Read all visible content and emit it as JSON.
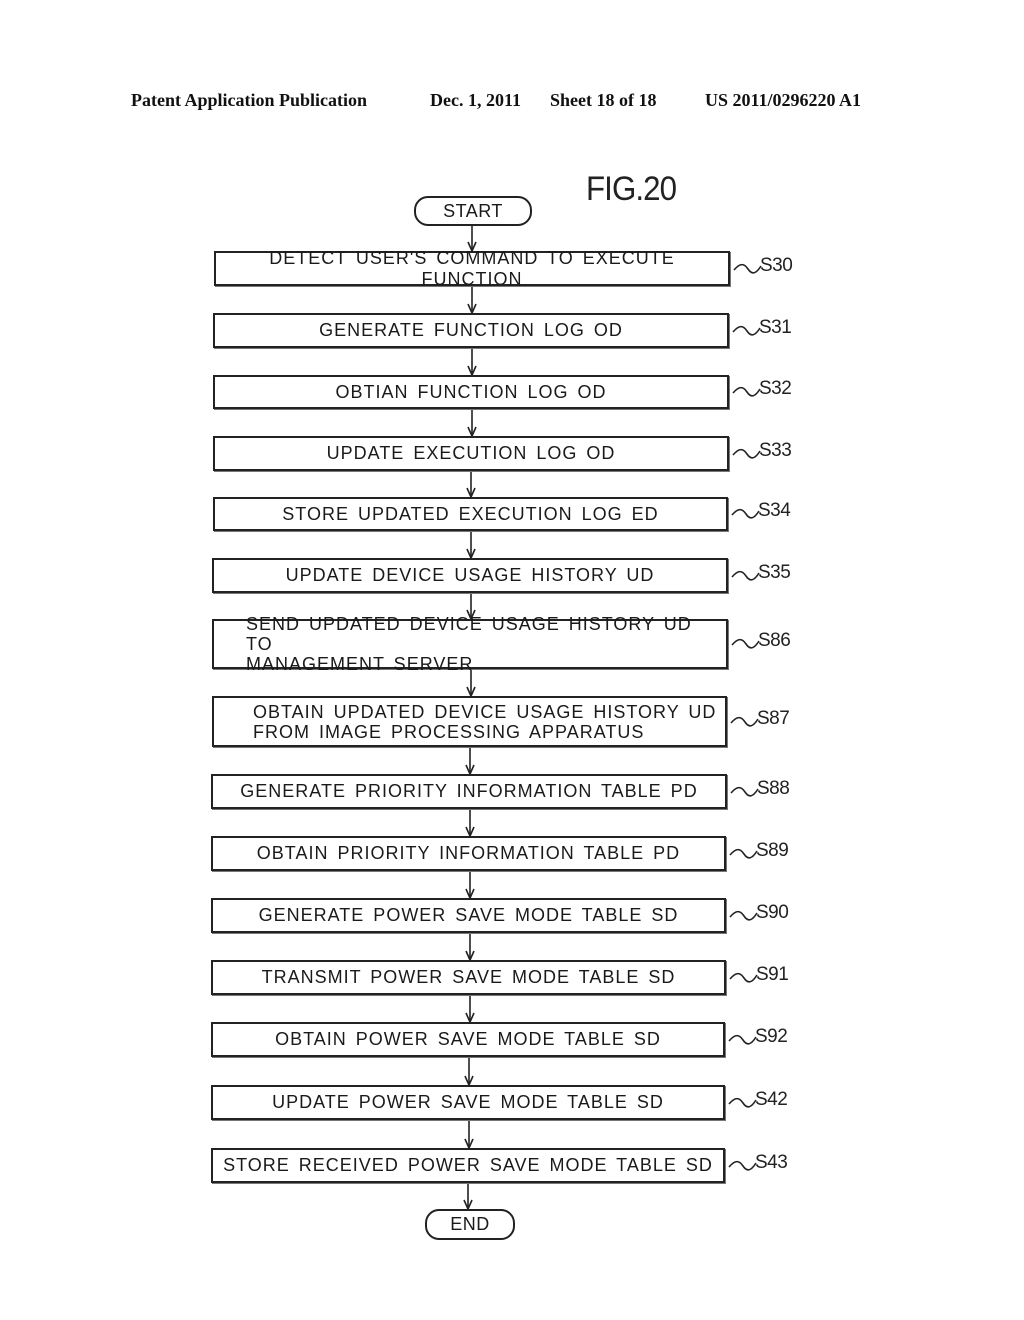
{
  "header": {
    "publication": "Patent Application Publication",
    "date": "Dec. 1, 2011",
    "sheet": "Sheet 18 of 18",
    "number": "US 2011/0296220 A1"
  },
  "figure": {
    "title": "FIG.20",
    "start_label": "START",
    "end_label": "END",
    "steps": [
      {
        "id": "S30",
        "label": "DETECT USER'S COMMAND TO EXECUTE FUNCTION"
      },
      {
        "id": "S31",
        "label": "GENERATE FUNCTION LOG OD"
      },
      {
        "id": "S32",
        "label": "OBTIAN FUNCTION LOG OD"
      },
      {
        "id": "S33",
        "label": "UPDATE EXECUTION LOG OD"
      },
      {
        "id": "S34",
        "label": "STORE UPDATED EXECUTION LOG ED"
      },
      {
        "id": "S35",
        "label": "UPDATE DEVICE USAGE HISTORY UD"
      },
      {
        "id": "S86",
        "label": "SEND UPDATED DEVICE USAGE HISTORY UD TO\nMANAGEMENT SERVER"
      },
      {
        "id": "S87",
        "label": "OBTAIN UPDATED DEVICE USAGE HISTORY UD\nFROM IMAGE PROCESSING APPARATUS"
      },
      {
        "id": "S88",
        "label": "GENERATE PRIORITY INFORMATION TABLE PD"
      },
      {
        "id": "S89",
        "label": "OBTAIN PRIORITY INFORMATION TABLE PD"
      },
      {
        "id": "S90",
        "label": "GENERATE POWER SAVE MODE TABLE SD"
      },
      {
        "id": "S91",
        "label": "TRANSMIT POWER SAVE MODE TABLE SD"
      },
      {
        "id": "S92",
        "label": "OBTAIN POWER SAVE MODE TABLE SD"
      },
      {
        "id": "S42",
        "label": "UPDATE POWER SAVE MODE TABLE SD"
      },
      {
        "id": "S43",
        "label": "STORE RECEIVED POWER SAVE MODE TABLE SD"
      }
    ]
  }
}
